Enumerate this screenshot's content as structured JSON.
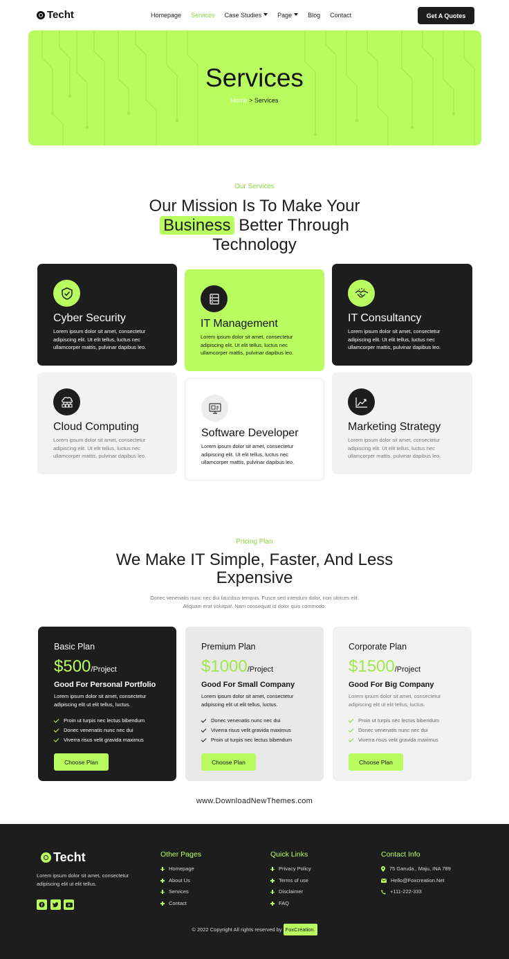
{
  "header": {
    "logo_text": "Techt",
    "nav": [
      {
        "label": "Homepage"
      },
      {
        "label": "Services",
        "active": true
      },
      {
        "label": "Case Studies",
        "dropdown": true
      },
      {
        "label": "Page",
        "dropdown": true
      },
      {
        "label": "Blog"
      },
      {
        "label": "Contact"
      }
    ],
    "cta_label": "Get A Quotes"
  },
  "hero": {
    "title": "Services",
    "breadcrumb_home": "Home",
    "breadcrumb_sep": " > ",
    "breadcrumb_current": "Services"
  },
  "services": {
    "eyebrow": "Our Services",
    "heading_line1": "Our Mission Is To Make Your",
    "heading_highlight": "Business",
    "heading_line2_rest": " Better Through",
    "heading_line3": "Technology",
    "cards": [
      {
        "title": "Cyber Security",
        "icon": "shield-icon",
        "text": "Lorem ipsum dolor sit amet, consectetur adipiscing elit. Ut elit tellus, luctus nec ullamcorper mattis, pulvinar dapibus leo."
      },
      {
        "title": "IT Management",
        "icon": "server-icon",
        "text": "Lorem ipsum dolor sit amet, consectetur adipiscing elit. Ut elit tellus, luctus nec ullamcorper mattis, pulvinar dapibus leo."
      },
      {
        "title": "IT Consultancy",
        "icon": "handshake-icon",
        "text": "Lorem ipsum dolor sit amet, consectetur adipiscing elit. Ut elit tellus, luctus nec ullamcorper mattis, pulvinar dapibus leo."
      },
      {
        "title": "Cloud Computing",
        "icon": "cloud-network-icon",
        "text": "Lorem ipsum dolor sit amet, consectetur adipiscing elit. Ut elit tellus, luctus nec ullamcorper mattis, pulvinar dapibus leo."
      },
      {
        "title": "Software Developer",
        "icon": "monitor-code-icon",
        "text": "Lorem ipsum dolor sit amet, consectetur adipiscing elit. Ut elit tellus, luctus nec ullamcorper mattis, pulvinar dapibus leo."
      },
      {
        "title": "Marketing Strategy",
        "icon": "chart-growth-icon",
        "text": "Lorem ipsum dolor sit amet, consectetur adipiscing elit. Ut elit tellus, luctus nec ullamcorper mattis, pulvinar dapibus leo."
      }
    ]
  },
  "pricing": {
    "eyebrow": "Pricing Plan",
    "heading_line1": "We Make IT Simple, Faster, And Less",
    "heading_line2": "Expensive",
    "sub_line1": "Donec venenatis nunc nec dui faucibus tempus. Fusce sed interdum dolor, non ultrices elit.",
    "sub_line2": "Aliquam erat volutpat. Nam consequat id dolor quis commodo.",
    "plans": [
      {
        "name": "Basic Plan",
        "amount": "$500",
        "per": "/Project",
        "tagline": "Good For Personal Portfolio",
        "desc": "Lorem ipsum dolor sit amet, consectetur adipiscing elit ut elit tellus, luctus.",
        "features": [
          "Proin ut turpis nec lectus bibendum",
          "Donec venenatis nunc nec dui",
          "Viverra risus velit gravida maximus"
        ],
        "button": "Choose Plan"
      },
      {
        "name": "Premium Plan",
        "amount": "$1000",
        "per": "/Project",
        "tagline": "Good For Small Company",
        "desc": "Lorem ipsum dolor sit amet, consectetur adipiscing elit ut elit tellus, luctus.",
        "features": [
          "Donec venenatis nunc nec dui",
          "Viverra risus velit gravida maximus",
          "Proin ut turpis nec lectus bibendum"
        ],
        "button": "Choose Plan"
      },
      {
        "name": "Corporate Plan",
        "amount": "$1500",
        "per": "/Project",
        "tagline": "Good For Big Company",
        "desc": "Lorem ipsum dolor sit amet, consectetur adipiscing elit ut elit tellus, luctus.",
        "features": [
          "Proin ut turpis nec lectus bibendum",
          "Donec venenatis nunc nec dui",
          "Viverra risus velit gravida maximus"
        ],
        "button": "Choose Plan"
      }
    ]
  },
  "watermark": "www.DownloadNewThemes.com",
  "footer": {
    "logo_text": "Techt",
    "desc": "Lorem ipsum dolor sit amet, consectetur adipiscing elit ut elit tellus.",
    "socials": [
      "facebook-icon",
      "twitter-icon",
      "youtube-icon"
    ],
    "other_pages": {
      "title": "Other Pages",
      "items": [
        "Homepage",
        "About Us",
        "Services",
        "Contact"
      ]
    },
    "quick_links": {
      "title": "Quick Links",
      "items": [
        "Privacy Policy",
        "Terms of use",
        "Disclaimer",
        "FAQ"
      ]
    },
    "contact": {
      "title": "Contact Info",
      "address": "75 Garuda., Maju, INA 789",
      "email": "Hello@Foxcreation.Net",
      "phone": "+111-222-333"
    },
    "copyright_text": "© 2022 Copyright All rights reserved by",
    "copyright_brand": "FoxCreation."
  },
  "colors": {
    "accent": "#b9fc60",
    "dark": "#1d1d1d",
    "light": "#f2f2f2"
  }
}
